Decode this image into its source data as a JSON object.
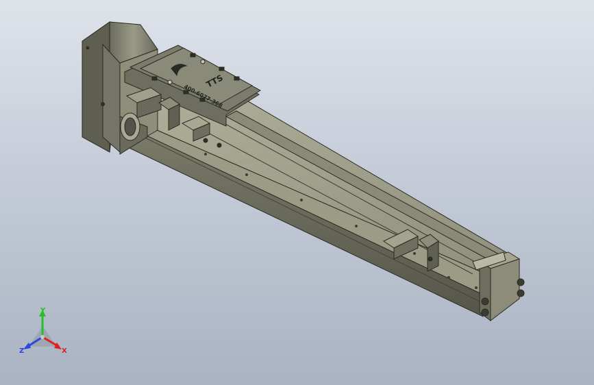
{
  "model": {
    "carriage_brand": "TTS",
    "carriage_phone": "400-6077-368"
  },
  "triad": {
    "x_label": "X",
    "y_label": "Y",
    "z_label": "Z",
    "x_color": "#e02020",
    "y_color": "#28c028",
    "z_color": "#2848e0"
  },
  "colors": {
    "background_top": "#dfe3ea",
    "background_bottom": "#aab3c3",
    "body_dark": "#5b5b50",
    "body_mid": "#8a8a78",
    "body_light": "#a6a692",
    "edge": "#2a2a24"
  }
}
